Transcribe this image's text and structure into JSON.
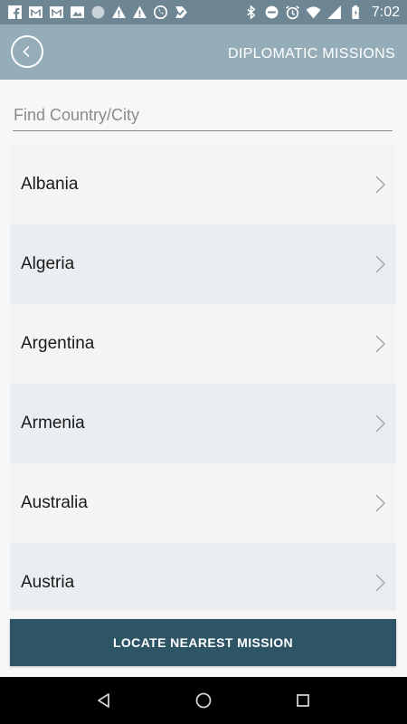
{
  "status_bar": {
    "time": "7:02",
    "left_icons": [
      "facebook-icon",
      "gmail-icon",
      "gmail-icon",
      "image-icon",
      "circle-icon",
      "warning-icon",
      "warning-icon",
      "whatsapp-icon",
      "tick-icon"
    ],
    "right_icons": [
      "bluetooth-icon",
      "do-not-disturb-icon",
      "alarm-icon",
      "wifi-icon",
      "signal-icon",
      "battery-icon"
    ]
  },
  "header": {
    "title": "DIPLOMATIC MISSIONS",
    "back_icon": "back-arrow-icon"
  },
  "search": {
    "placeholder": "Find Country/City",
    "value": ""
  },
  "countries": [
    {
      "label": "Albania"
    },
    {
      "label": "Algeria"
    },
    {
      "label": "Argentina"
    },
    {
      "label": "Armenia"
    },
    {
      "label": "Australia"
    },
    {
      "label": "Austria"
    }
  ],
  "footer_button": {
    "label": "LOCATE NEAREST MISSION"
  },
  "nav_bar": {
    "buttons": [
      "back-triangle-icon",
      "home-circle-icon",
      "recents-square-icon"
    ]
  },
  "colors": {
    "status_bar": "#6e8593",
    "header": "#95adb9",
    "button": "#2e5566",
    "row_odd": "#f4f4f4",
    "row_even": "#eaeef1"
  }
}
